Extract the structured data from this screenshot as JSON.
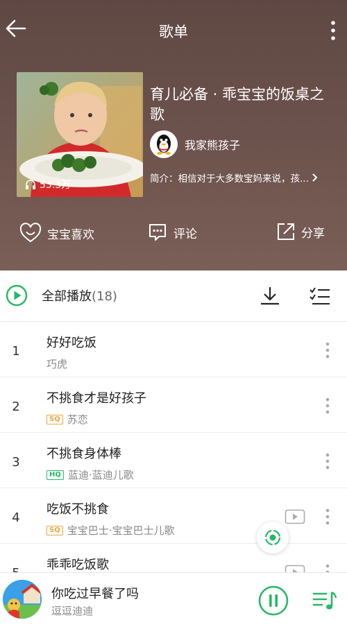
{
  "topbar": {
    "title": "歌单"
  },
  "playlist": {
    "title": "育儿必备 · 乖宝宝的饭桌之歌",
    "play_count": "53.3万",
    "creator": "我家熊孩子",
    "intro": "简介：相信对于大多数宝妈来说，孩..."
  },
  "actions": {
    "like": "宝宝喜欢",
    "comment": "评论",
    "share": "分享"
  },
  "playall": {
    "label": "全部播放",
    "count": "(18)"
  },
  "songs": [
    {
      "num": "1",
      "title": "好好吃饭",
      "badge": "",
      "artist": "巧虎",
      "mv": false
    },
    {
      "num": "2",
      "title": "不挑食才是好孩子",
      "badge": "SQ",
      "artist": "苏恋",
      "mv": false
    },
    {
      "num": "3",
      "title": "不挑食身体棒",
      "badge": "HQ",
      "artist": "蓝迪·蓝迪儿歌",
      "mv": false
    },
    {
      "num": "4",
      "title": "吃饭不挑食",
      "badge": "SQ",
      "artist": "宝宝巴士·宝宝巴士儿歌",
      "mv": true
    },
    {
      "num": "5",
      "title": "乖乖吃饭歌",
      "badge": "",
      "artist": "",
      "mv": true
    }
  ],
  "mini_player": {
    "title": "你吃过早餐了吗",
    "artist": "逗逗迪迪"
  },
  "colors": {
    "accent": "#25b964",
    "hq": "#25b964",
    "sq": "#e9a63a",
    "hero_bg": "#6b514b"
  }
}
